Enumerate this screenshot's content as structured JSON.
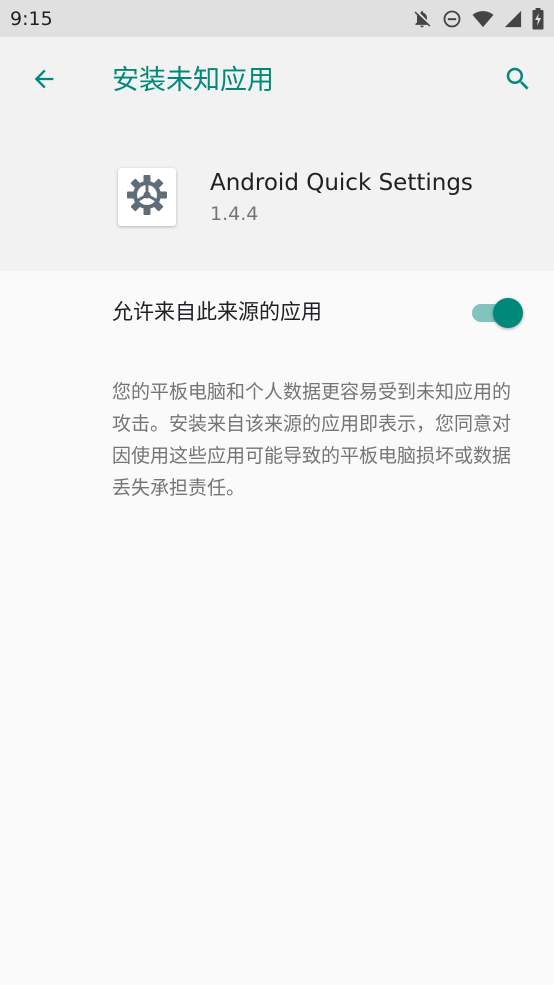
{
  "status_bar": {
    "time": "9:15",
    "icons": [
      "notifications-off-icon",
      "do-not-disturb-icon",
      "wifi-icon",
      "signal-icon",
      "battery-charging-icon"
    ]
  },
  "app_bar": {
    "title": "安装未知应用",
    "back_icon": "arrow-back-icon",
    "search_icon": "search-icon"
  },
  "app_info": {
    "name": "Android Quick Settings",
    "version": "1.4.4",
    "icon": "gear-icon"
  },
  "setting": {
    "label": "允许来自此来源的应用",
    "enabled": true
  },
  "warning": {
    "text": "您的平板电脑和个人数据更容易受到未知应用的攻击。安装来自该来源的应用即表示，您同意对因使用这些应用可能导致的平板电脑损坏或数据丢失承担责任。"
  },
  "colors": {
    "accent": "#00897b",
    "accent_light": "#80c4bd",
    "status_bar_bg": "#e0e0e0",
    "header_bg": "#f2f2f2",
    "page_bg": "#fafafa"
  }
}
